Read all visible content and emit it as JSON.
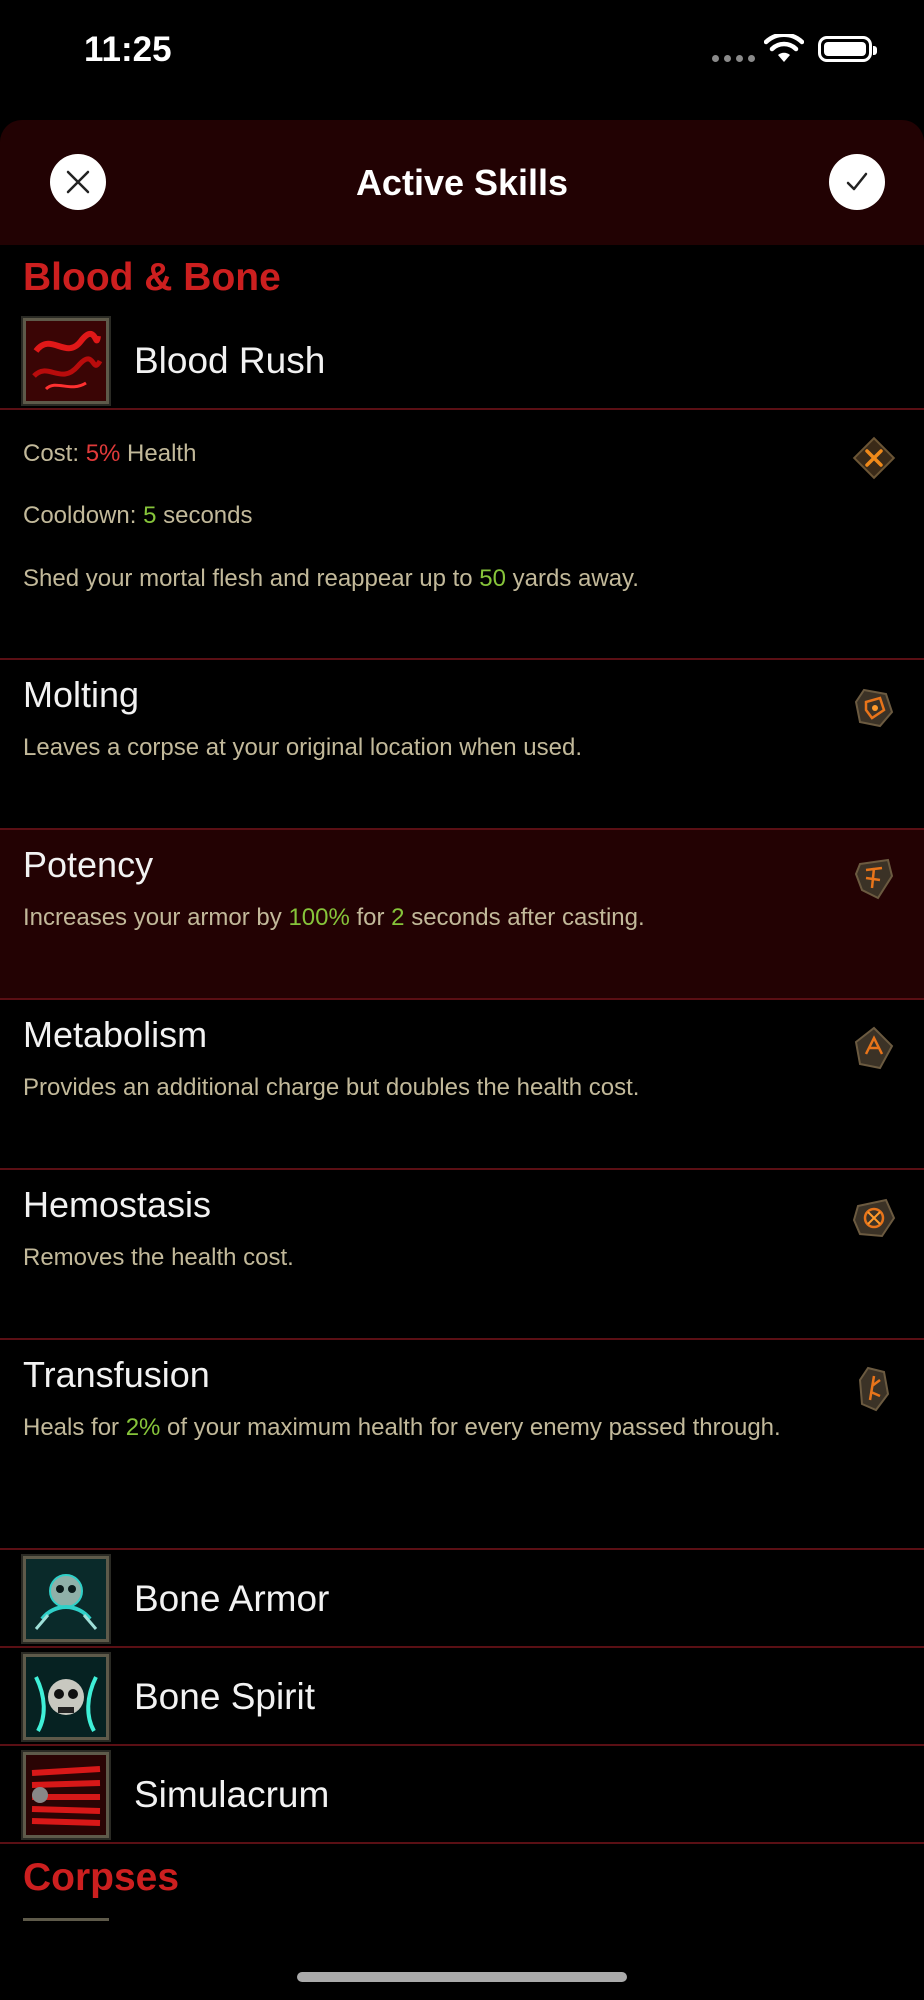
{
  "status": {
    "time": "11:25"
  },
  "header": {
    "title": "Active Skills"
  },
  "sections": {
    "blood_bone": "Blood & Bone",
    "corpses": "Corpses"
  },
  "blood_rush": {
    "name": "Blood Rush",
    "cost_label": "Cost: ",
    "cost_value": "5%",
    "cost_unit": " Health",
    "cooldown_label": "Cooldown: ",
    "cooldown_value": "5",
    "cooldown_unit": " seconds",
    "desc_pre": "Shed your mortal flesh and reappear up to ",
    "desc_value": "50",
    "desc_post": " yards away."
  },
  "runes": [
    {
      "title": "Molting",
      "desc": "Leaves a corpse at your original location when used."
    },
    {
      "title": "Potency",
      "desc_pre": "Increases your armor by ",
      "v1": "100%",
      "mid": " for ",
      "v2": "2",
      "desc_post": " seconds after casting."
    },
    {
      "title": "Metabolism",
      "desc": "Provides an additional charge but doubles the health cost."
    },
    {
      "title": "Hemostasis",
      "desc": "Removes the health cost."
    },
    {
      "title": "Transfusion",
      "desc_pre": "Heals for ",
      "v1": "2%",
      "desc_post": " of your maximum health for every enemy passed through."
    }
  ],
  "skills": [
    {
      "name": "Bone Armor"
    },
    {
      "name": "Bone Spirit"
    },
    {
      "name": "Simulacrum"
    }
  ],
  "colors": {
    "accent_red": "#cc1f1f",
    "value_green": "#86c43a",
    "value_red": "#e03a3a",
    "selected_bg": "#230203"
  }
}
